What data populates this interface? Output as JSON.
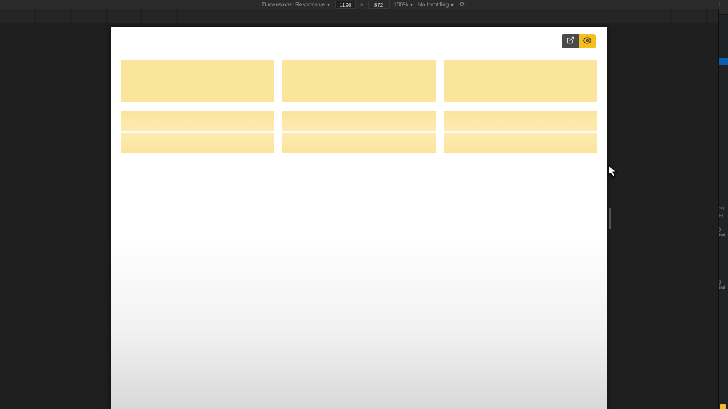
{
  "toolbar": {
    "dimensions_label": "Dimensions:",
    "dimensions_mode": "Responsive",
    "width": "1196",
    "separator": "×",
    "height": "872",
    "zoom": "100%",
    "throttling": "No throttling"
  },
  "right_panel": {
    "styles_label": "Sty",
    "filter_label": "Fil",
    "brace_open": "}",
    "ref1": "ind",
    "brace2": "}",
    "ref2": "ind"
  },
  "colors": {
    "card_bg": "#fbe49b",
    "accent": "#f7bd1e",
    "dark_btn": "#4a4a4a",
    "page_bg": "#ffffff"
  }
}
